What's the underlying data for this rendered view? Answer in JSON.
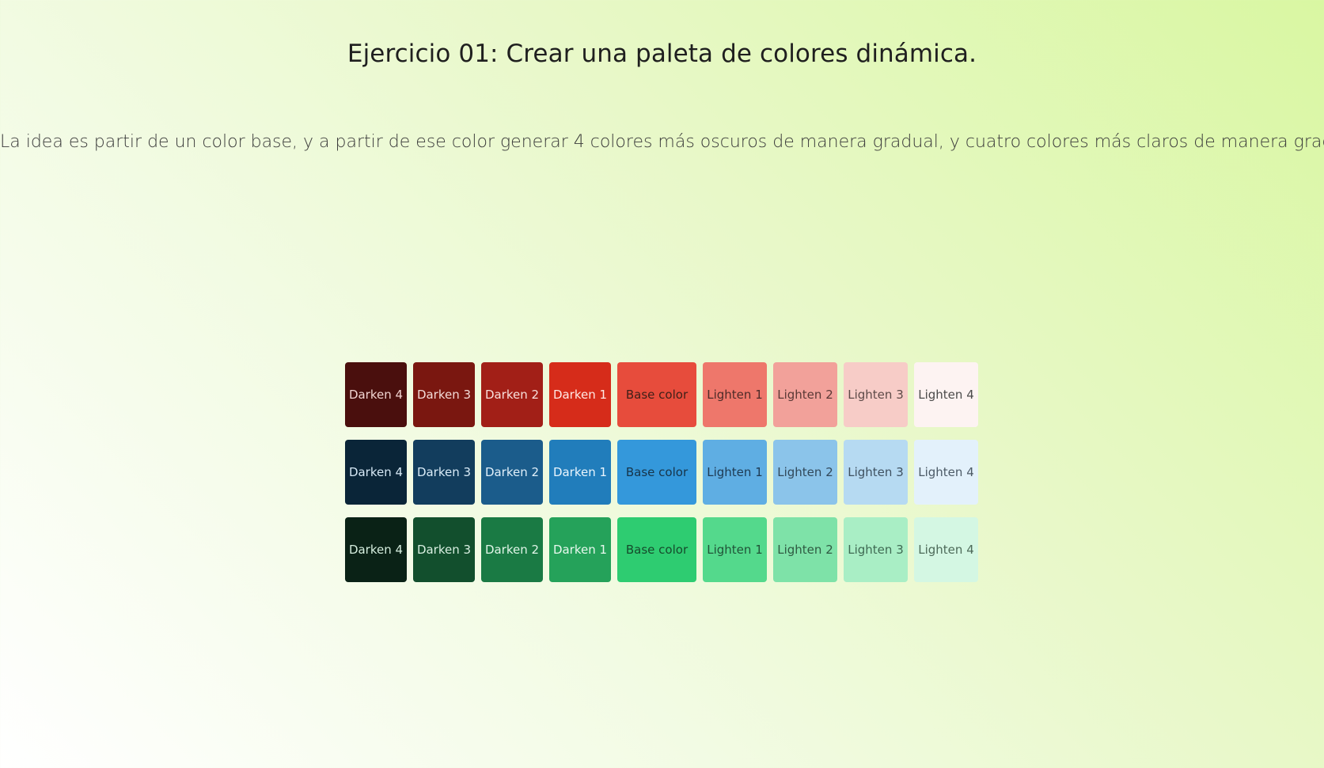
{
  "page": {
    "title": "Ejercicio 01: Crear una paleta de colores dinámica.",
    "description": "La idea es partir de un color base, y a partir de ese color generar 4 colores más oscuros de manera gradual, y cuatro colores más claros de manera gradual."
  },
  "palette": {
    "rows": [
      {
        "base_color": "#e74c3c",
        "swatches": [
          {
            "label": "Darken 4",
            "color": "#4a0f0d",
            "text_color": "#f1d4d1"
          },
          {
            "label": "Darken 3",
            "color": "#7a1710",
            "text_color": "#f3dcd8"
          },
          {
            "label": "Darken 2",
            "color": "#a21f17",
            "text_color": "#f8e1dd"
          },
          {
            "label": "Darken 1",
            "color": "#d62c1a",
            "text_color": "#ffe9e5"
          },
          {
            "label": "Base color",
            "color": "#e74c3c",
            "text_color": "#402019"
          },
          {
            "label": "Lighten 1",
            "color": "#ee776b",
            "text_color": "#4d2b28"
          },
          {
            "label": "Lighten 2",
            "color": "#f2a19a",
            "text_color": "#5a3936"
          },
          {
            "label": "Lighten 3",
            "color": "#f7ccc7",
            "text_color": "#5d4a48"
          },
          {
            "label": "Lighten 4",
            "color": "#fdf3f2",
            "text_color": "#4a4a4a"
          }
        ]
      },
      {
        "base_color": "#3498db",
        "swatches": [
          {
            "label": "Darken 4",
            "color": "#0a2538",
            "text_color": "#d6e8f5"
          },
          {
            "label": "Darken 3",
            "color": "#123d5d",
            "text_color": "#d9ebf7"
          },
          {
            "label": "Darken 2",
            "color": "#1b5c8b",
            "text_color": "#e1f0fa"
          },
          {
            "label": "Darken 1",
            "color": "#217dbb",
            "text_color": "#eaf5fd"
          },
          {
            "label": "Base color",
            "color": "#3498db",
            "text_color": "#173449"
          },
          {
            "label": "Lighten 1",
            "color": "#5faee3",
            "text_color": "#1e3a52"
          },
          {
            "label": "Lighten 2",
            "color": "#8bc4ea",
            "text_color": "#31485a"
          },
          {
            "label": "Lighten 3",
            "color": "#b6daf2",
            "text_color": "#3f5160"
          },
          {
            "label": "Lighten 4",
            "color": "#e3f1fb",
            "text_color": "#4c5a66"
          }
        ]
      },
      {
        "base_color": "#2ecc71",
        "swatches": [
          {
            "label": "Darken 4",
            "color": "#0a2216",
            "text_color": "#d5eede"
          },
          {
            "label": "Darken 3",
            "color": "#124f2d",
            "text_color": "#d9efe1"
          },
          {
            "label": "Darken 2",
            "color": "#1a7a44",
            "text_color": "#e1f5e8"
          },
          {
            "label": "Darken 1",
            "color": "#25a25a",
            "text_color": "#e8f8ee"
          },
          {
            "label": "Base color",
            "color": "#2ecc71",
            "text_color": "#164b2c"
          },
          {
            "label": "Lighten 1",
            "color": "#54d98c",
            "text_color": "#215338"
          },
          {
            "label": "Lighten 2",
            "color": "#7ee2a8",
            "text_color": "#2f5a42"
          },
          {
            "label": "Lighten 3",
            "color": "#a9eec5",
            "text_color": "#3f6a53"
          },
          {
            "label": "Lighten 4",
            "color": "#d4f7e3",
            "text_color": "#4d6a59"
          }
        ]
      }
    ]
  }
}
